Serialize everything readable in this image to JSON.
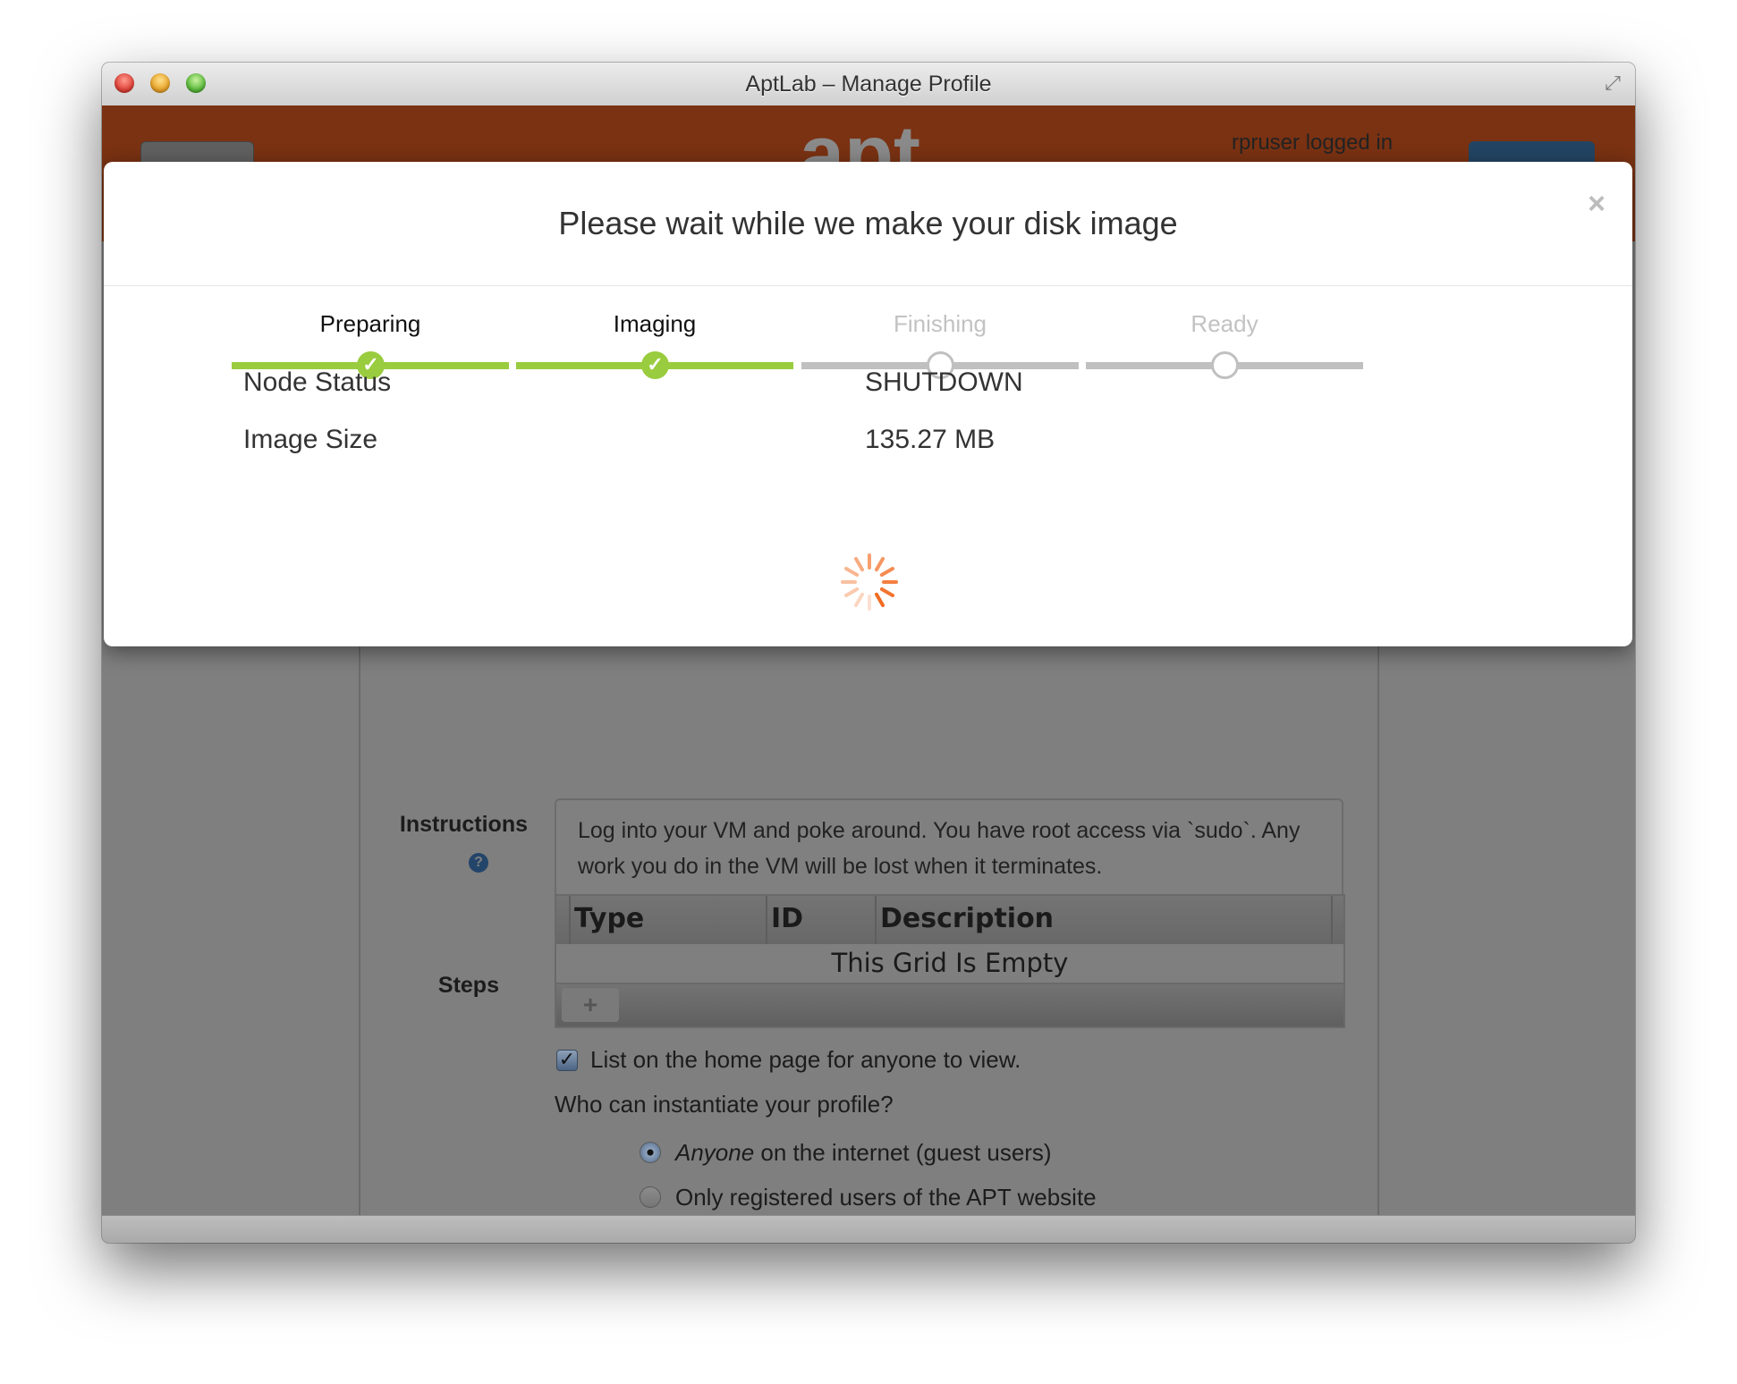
{
  "window": {
    "title": "AptLab – Manage Profile"
  },
  "header": {
    "logo": "apt",
    "user_status": "rpruser logged in"
  },
  "form": {
    "instructions_label": "Instructions",
    "instructions_text": "Log into your VM and poke around. You have root access via `sudo`. Any work you do in the VM will be lost when it terminates.",
    "help_icon_glyph": "?",
    "steps_label": "Steps",
    "steps_grid": {
      "columns": [
        "Type",
        "ID",
        "Description"
      ],
      "empty_text": "This Grid Is Empty",
      "add_button": "+"
    },
    "list_on_home": {
      "label": "List on the home page for anyone to view.",
      "checked": true
    },
    "who_question": "Who can instantiate your profile?",
    "radio_options": [
      {
        "emphasis": "Anyone",
        "label": " on the internet (guest users)",
        "selected": true
      },
      {
        "emphasis": "",
        "label": "Only registered users of the APT website",
        "selected": false
      }
    ]
  },
  "modal": {
    "title": "Please wait while we make your disk image",
    "close": "×",
    "steps": [
      {
        "label": "Preparing",
        "state": "done"
      },
      {
        "label": "Imaging",
        "state": "done"
      },
      {
        "label": "Finishing",
        "state": "pending"
      },
      {
        "label": "Ready",
        "state": "pending"
      }
    ],
    "status": [
      {
        "label": "Node Status",
        "value": "SHUTDOWN"
      },
      {
        "label": "Image Size",
        "value": "135.27 MB"
      }
    ],
    "colors": {
      "done": "#99cc3e",
      "pending": "#c0c0c0",
      "spinner": "#f26b21"
    }
  }
}
